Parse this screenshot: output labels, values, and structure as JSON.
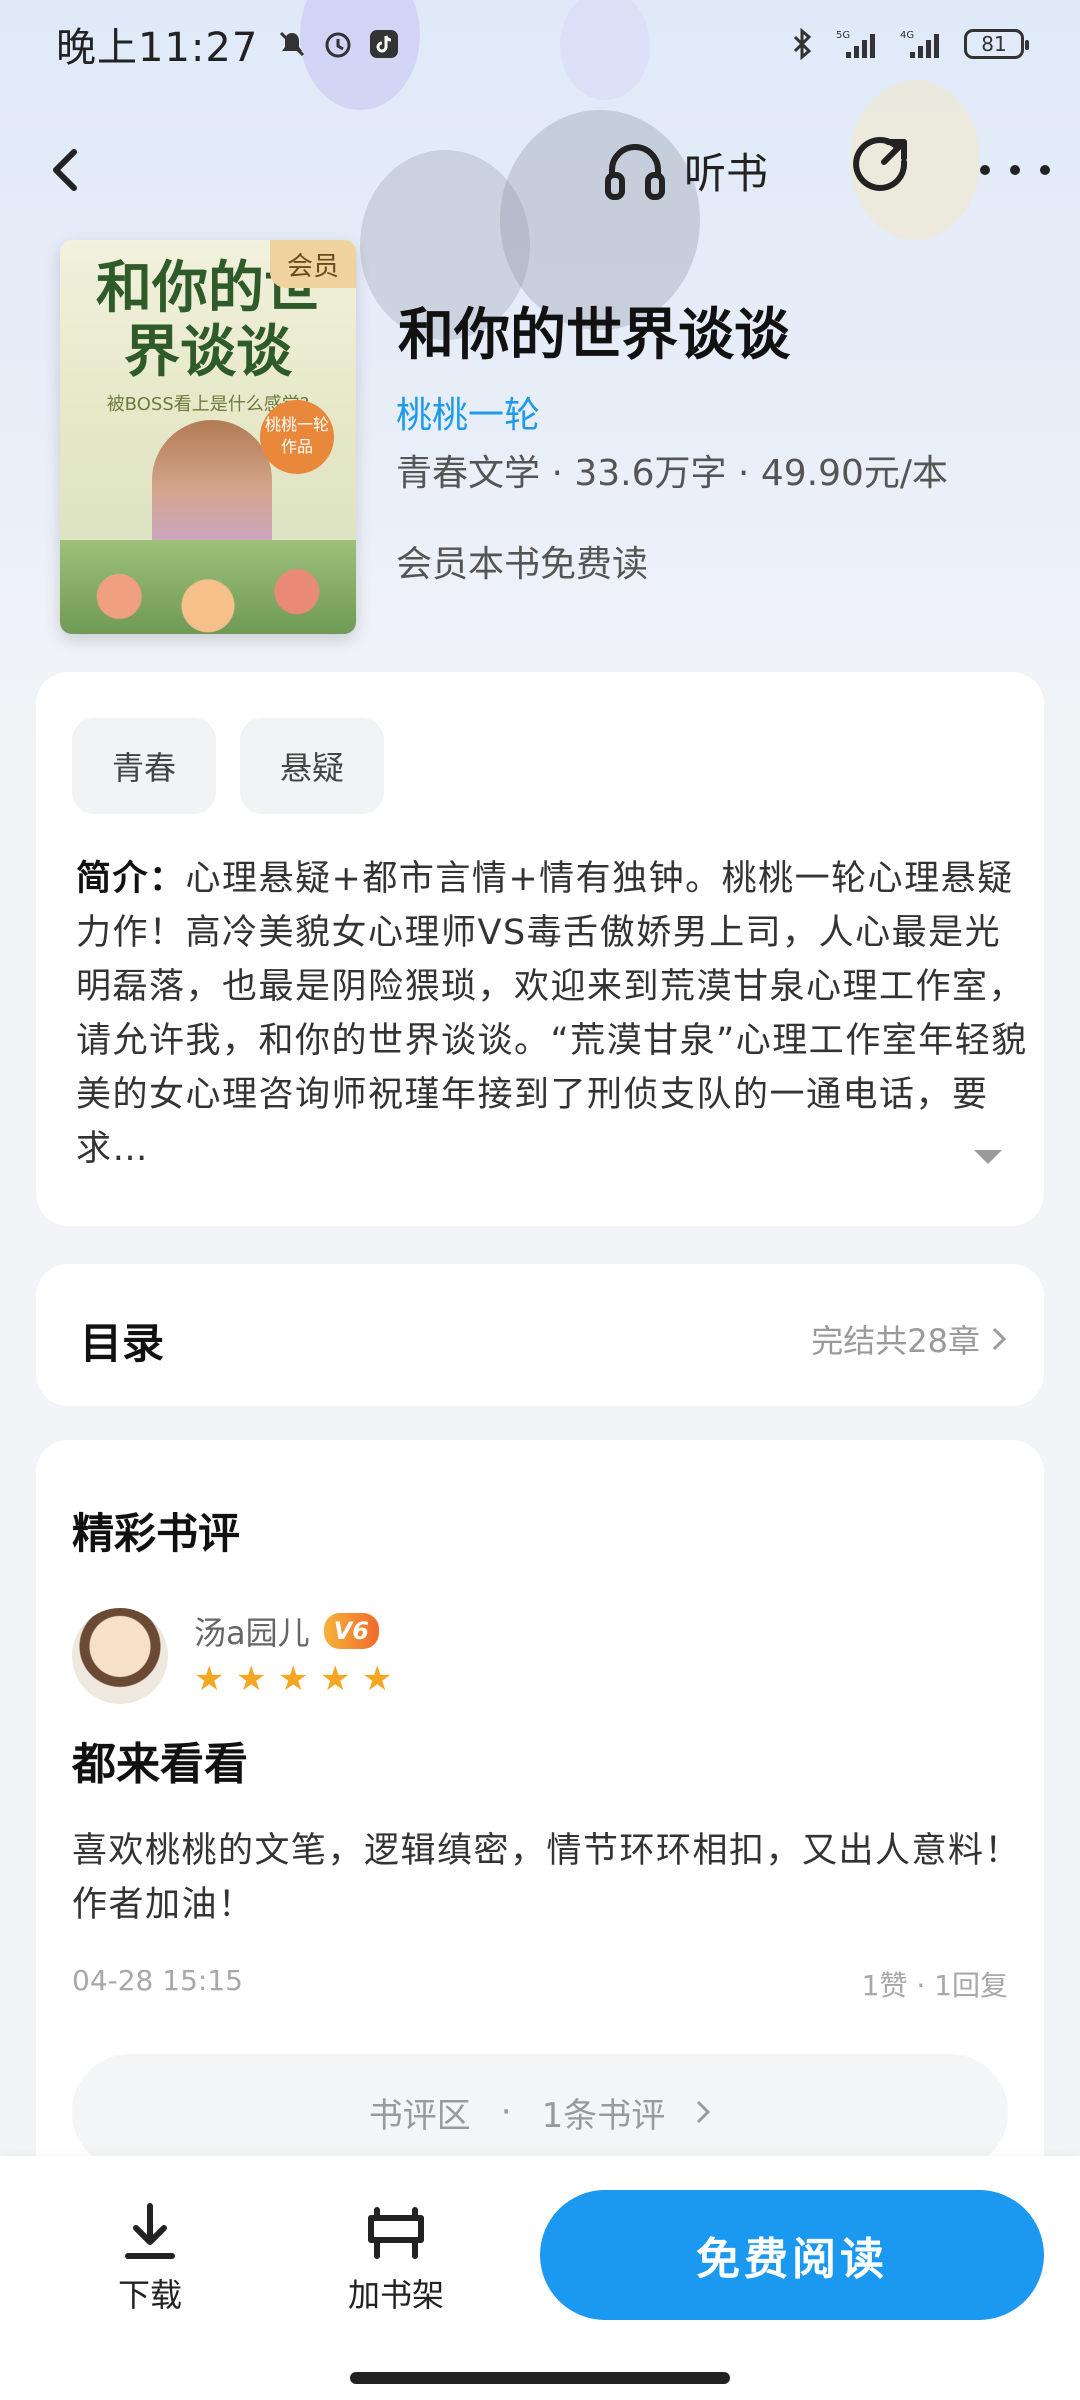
{
  "status_bar": {
    "time": "晚上11:27",
    "battery": "81",
    "signal1": "5G",
    "signal2": "4G"
  },
  "nav": {
    "listen_label": "听书"
  },
  "book": {
    "cover_title": "和你的世界谈谈",
    "cover_subtitle": "被BOSS看上是什么感觉?",
    "cover_seal": "桃桃一轮作品",
    "vip_tag": "会员",
    "title": "和你的世界谈谈",
    "author": "桃桃一轮",
    "meta": "青春文学 · 33.6万字 · 49.90元/本",
    "member_note": "会员本书免费读"
  },
  "intro": {
    "tags": [
      "青春",
      "悬疑"
    ],
    "label": "简介：",
    "text": "心理悬疑+都市言情+情有独钟。桃桃一轮心理悬疑力作！高冷美貌女心理师VS毒舌傲娇男上司，人心最是光明磊落，也最是阴险猥琐，欢迎来到荒漠甘泉心理工作室，请允许我，和你的世界谈谈。“荒漠甘泉”心理工作室年轻貌美的女心理咨询师祝瑾年接到了刑侦支队的一通电话，要求…"
  },
  "toc": {
    "title": "目录",
    "status": "完结共28章"
  },
  "review": {
    "heading": "精彩书评",
    "user": "汤a园儿",
    "level": "V6",
    "rating": 5,
    "title": "都来看看",
    "body": "喜欢桃桃的文笔，逻辑缜密，情节环环相扣，又出人意料！作者加油！",
    "time": "04-28  15:15",
    "stats": "1赞 · 1回复",
    "area_label": "书评区",
    "area_sep": "·",
    "area_count": "1条书评"
  },
  "bottom_bar": {
    "download": "下载",
    "add_shelf": "加书架",
    "read_free": "免费阅读"
  },
  "colors": {
    "accent": "#1b99f0",
    "author": "#1e9be8",
    "star": "#f5a623"
  }
}
